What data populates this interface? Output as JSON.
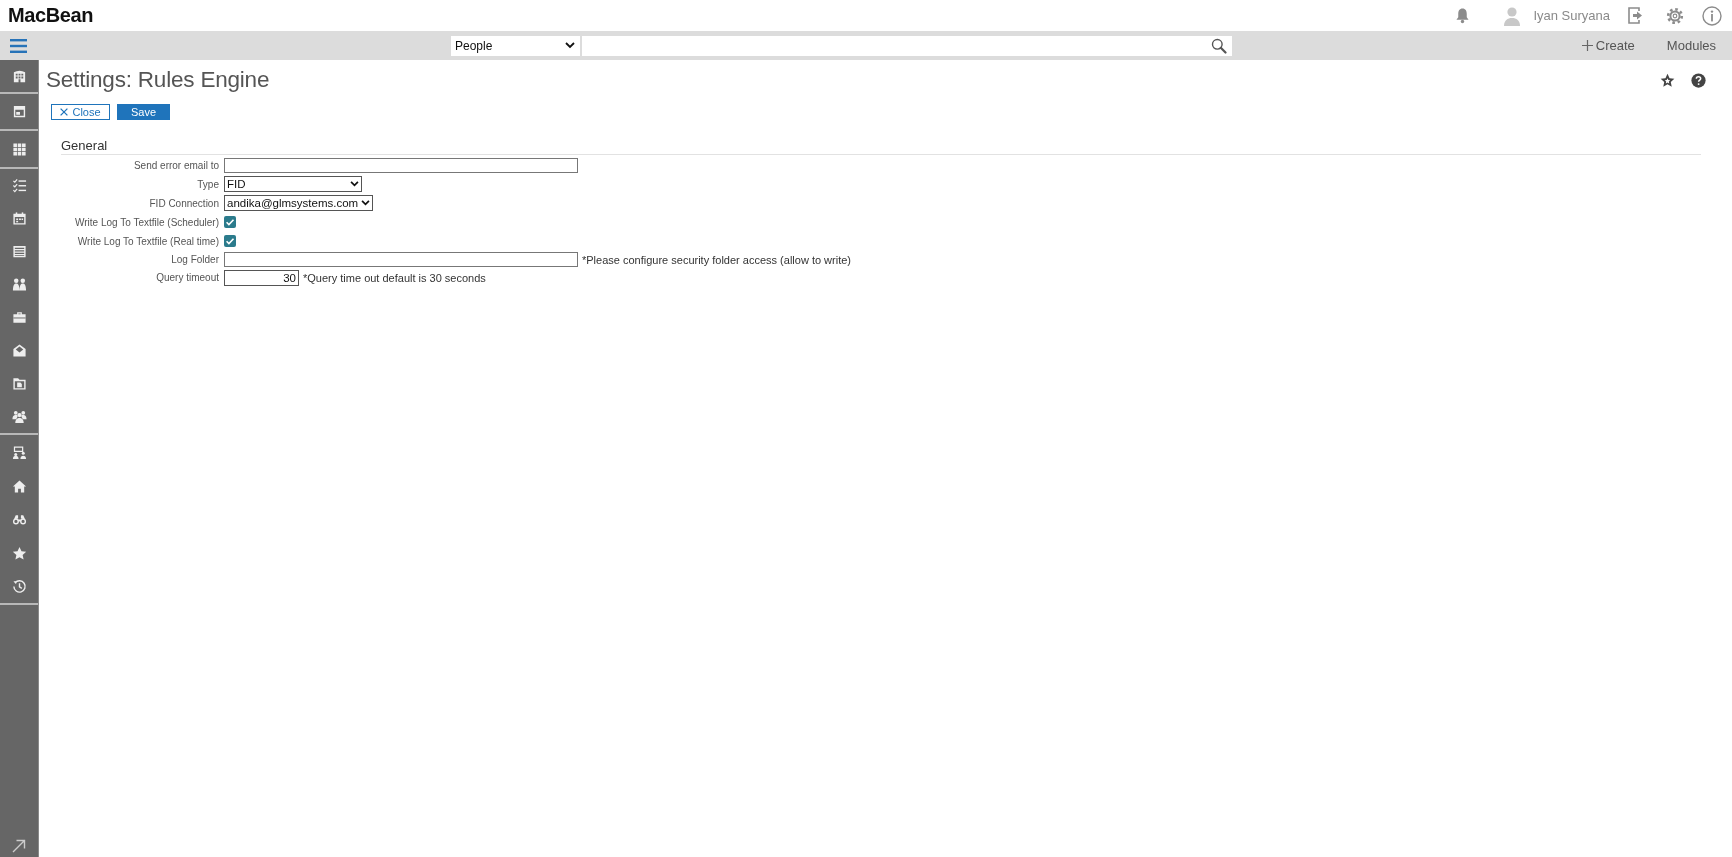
{
  "app": {
    "logo": "MacBean"
  },
  "header": {
    "user_name": "Iyan Suryana"
  },
  "search": {
    "scope": "People"
  },
  "nav_actions": [
    {
      "label": "Create",
      "kind": "create"
    },
    {
      "label": "Modules",
      "kind": "modules"
    }
  ],
  "page": {
    "title": "Settings: Rules Engine",
    "buttons": [
      {
        "label": "Close",
        "kind": "close"
      },
      {
        "label": "Save",
        "kind": "save"
      }
    ]
  },
  "form": {
    "section": "General",
    "fields": [
      {
        "label": "Send error email to",
        "kind": "text"
      },
      {
        "label": "Type",
        "kind": "select",
        "value": "FID"
      },
      {
        "label": "FID Connection",
        "kind": "select",
        "value": "andika@glmsystems.com"
      },
      {
        "label": "Write Log To Textfile (Scheduler)",
        "kind": "checkbox",
        "checked": true
      },
      {
        "label": "Write Log To Textfile (Real time)",
        "kind": "checkbox",
        "checked": true
      },
      {
        "label": "Log Folder",
        "kind": "text",
        "note": "*Please configure security folder access (allow to write)"
      },
      {
        "label": "Query timeout",
        "kind": "number",
        "value": "30",
        "note": "*Query time out default is 30 seconds"
      }
    ]
  }
}
